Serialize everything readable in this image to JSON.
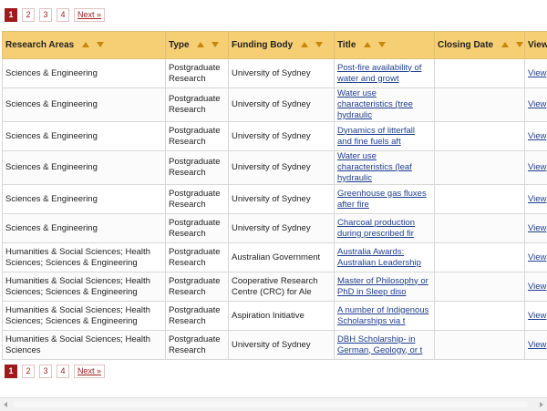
{
  "pagination": {
    "pages": [
      "1",
      "2",
      "3",
      "4"
    ],
    "current": "1",
    "next_label": "Next »"
  },
  "table": {
    "columns": [
      {
        "label": "Research Areas",
        "sortable": true
      },
      {
        "label": "Type",
        "sortable": true
      },
      {
        "label": "Funding Body",
        "sortable": true
      },
      {
        "label": "Title",
        "sortable": true
      },
      {
        "label": "Closing Date",
        "sortable": true
      },
      {
        "label": "View",
        "sortable": false
      }
    ],
    "rows": [
      {
        "area": "Sciences & Engineering",
        "type": "Postgraduate Research",
        "funding": "University of Sydney",
        "title": "Post-fire availability of water and growt",
        "closing": "",
        "view": "View"
      },
      {
        "area": "Sciences & Engineering",
        "type": "Postgraduate Research",
        "funding": "University of Sydney",
        "title": "Water use characteristics (tree hydraulic",
        "closing": "",
        "view": "View"
      },
      {
        "area": "Sciences & Engineering",
        "type": "Postgraduate Research",
        "funding": "University of Sydney",
        "title": "Dynamics of litterfall and fine fuels aft",
        "closing": "",
        "view": "View"
      },
      {
        "area": "Sciences & Engineering",
        "type": "Postgraduate Research",
        "funding": "University of Sydney",
        "title": "Water use characteristics (leaf hydraulic",
        "closing": "",
        "view": "View"
      },
      {
        "area": "Sciences & Engineering",
        "type": "Postgraduate Research",
        "funding": "University of Sydney",
        "title": "Greenhouse gas fluxes after fire",
        "closing": "",
        "view": "View"
      },
      {
        "area": "Sciences & Engineering",
        "type": "Postgraduate Research",
        "funding": "University of Sydney",
        "title": "Charcoal production during prescribed fir",
        "closing": "",
        "view": "View"
      },
      {
        "area": "Humanities & Social Sciences; Health Sciences; Sciences & Engineering",
        "type": "Postgraduate Research",
        "funding": "Australian Government",
        "title": "Australia Awards: Australian Leadership",
        "closing": "",
        "view": "View"
      },
      {
        "area": "Humanities & Social Sciences; Health Sciences; Sciences & Engineering",
        "type": "Postgraduate Research",
        "funding": "Cooperative Research Centre (CRC) for Ale",
        "title": "Master of Philosophy or PhD in Sleep diso",
        "closing": "",
        "view": "View"
      },
      {
        "area": "Humanities & Social Sciences; Health Sciences; Sciences & Engineering",
        "type": "Postgraduate Research",
        "funding": "Aspiration Initiative",
        "title": "A number of Indigenous Scholarships via t",
        "closing": "",
        "view": "View"
      },
      {
        "area": "Humanities & Social Sciences; Health Sciences",
        "type": "Postgraduate Research",
        "funding": "University of Sydney",
        "title": "DBH Scholarship- in German, Geology, or t",
        "closing": "",
        "view": "View"
      }
    ]
  }
}
